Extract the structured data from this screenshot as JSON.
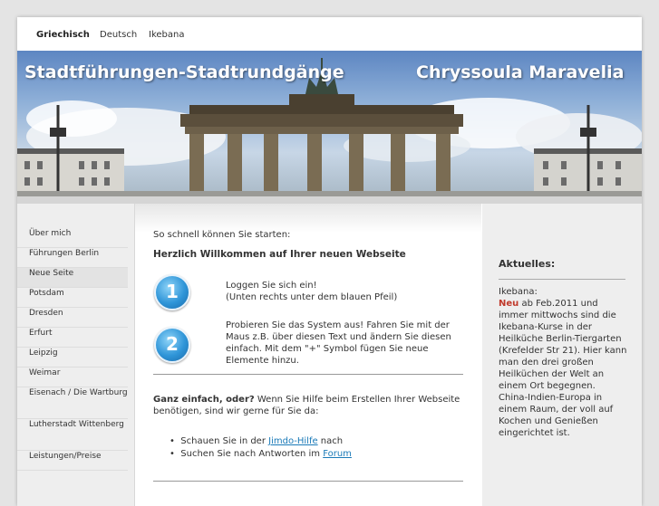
{
  "topnav": {
    "items": [
      {
        "label": "Griechisch",
        "active": true
      },
      {
        "label": "Deutsch",
        "active": false
      },
      {
        "label": "Ikebana",
        "active": false
      }
    ]
  },
  "header": {
    "title_left": "Stadtführungen-Stadtrundgänge",
    "title_right": "Chryssoula Maravelia"
  },
  "sidebar": {
    "items": [
      {
        "label": "Über mich"
      },
      {
        "label": "Führungen Berlin"
      },
      {
        "label": "Neue Seite",
        "selected": true
      },
      {
        "label": "Potsdam"
      },
      {
        "label": "Dresden"
      },
      {
        "label": "Erfurt"
      },
      {
        "label": "Leipzig"
      },
      {
        "label": "Weimar"
      },
      {
        "label": "Eisenach / Die Wartburg"
      },
      {
        "label": "Lutherstadt Wittenberg"
      },
      {
        "label": "Leistungen/Preise"
      }
    ]
  },
  "content": {
    "intro": "So schnell können Sie starten:",
    "heading": "Herzlich Willkommen auf Ihrer neuen Webseite",
    "step1_number": "1",
    "step1_line1": "Loggen Sie sich ein!",
    "step1_line2": "(Unten rechts unter dem blauen Pfeil)",
    "step2_number": "2",
    "step2_text": "Probieren Sie das System aus! Fahren Sie mit der Maus z.B. über diesen Text und ändern Sie diesen einfach. Mit dem \"+\" Symbol fügen Sie neue Elemente hinzu.",
    "help_bold": "Ganz einfach, oder?",
    "help_text": " Wenn Sie Hilfe beim Erstellen Ihrer Webseite benötigen, sind wir gerne für Sie da:",
    "bullet1_pre": "Schauen Sie in der ",
    "bullet1_link": "Jimdo-Hilfe",
    "bullet1_post": " nach",
    "bullet2_pre": "Suchen Sie nach Antworten im ",
    "bullet2_link": "Forum"
  },
  "aside": {
    "heading": "Aktuelles:",
    "label": "Ikebana:",
    "new_tag": "Neu",
    "text": " ab Feb.2011 und immer mittwochs sind die Ikebana-Kurse in der Heilküche Berlin-Tiergarten (Krefelder Str 21). Hier kann man den drei großen Heilküchen der Welt an einem Ort begegnen. China-Indien-Europa in einem Raum, der voll auf Kochen und Genießen eingerichtet ist."
  }
}
